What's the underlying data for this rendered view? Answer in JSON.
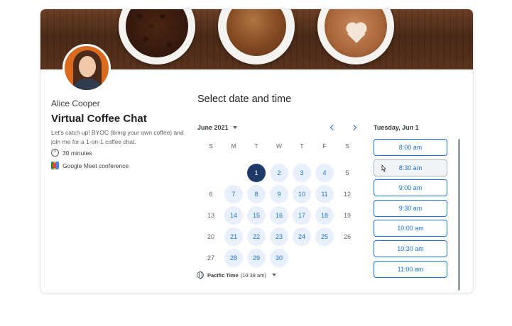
{
  "host": {
    "name": "Alice Cooper"
  },
  "event": {
    "title": "Virtual Coffee Chat",
    "description": "Let's catch up! BYOC (bring your own coffee) and join me for a 1-on-1 coffee chat.",
    "duration": "30 minutes",
    "conference": "Google Meet conference"
  },
  "scheduler": {
    "heading": "Select date and time",
    "month_label": "June 2021",
    "weekdays": [
      "S",
      "M",
      "T",
      "W",
      "T",
      "F",
      "S"
    ],
    "weeks": [
      [
        {
          "d": ""
        },
        {
          "d": ""
        },
        {
          "d": "1",
          "s": "selected"
        },
        {
          "d": "2",
          "s": "available"
        },
        {
          "d": "3",
          "s": "available"
        },
        {
          "d": "4",
          "s": "available"
        },
        {
          "d": "5",
          "s": "none"
        }
      ],
      [
        {
          "d": "6",
          "s": "none"
        },
        {
          "d": "7",
          "s": "available"
        },
        {
          "d": "8",
          "s": "available"
        },
        {
          "d": "9",
          "s": "available"
        },
        {
          "d": "10",
          "s": "available"
        },
        {
          "d": "11",
          "s": "available"
        },
        {
          "d": "12",
          "s": "none"
        }
      ],
      [
        {
          "d": "13",
          "s": "none"
        },
        {
          "d": "14",
          "s": "available"
        },
        {
          "d": "15",
          "s": "available"
        },
        {
          "d": "16",
          "s": "available"
        },
        {
          "d": "17",
          "s": "available"
        },
        {
          "d": "18",
          "s": "available"
        },
        {
          "d": "19",
          "s": "none"
        }
      ],
      [
        {
          "d": "20",
          "s": "none"
        },
        {
          "d": "21",
          "s": "available"
        },
        {
          "d": "22",
          "s": "available"
        },
        {
          "d": "23",
          "s": "available"
        },
        {
          "d": "24",
          "s": "available"
        },
        {
          "d": "25",
          "s": "available"
        },
        {
          "d": "26",
          "s": "none"
        }
      ],
      [
        {
          "d": "27",
          "s": "none"
        },
        {
          "d": "28",
          "s": "available"
        },
        {
          "d": "29",
          "s": "available"
        },
        {
          "d": "30",
          "s": "available"
        },
        {
          "d": ""
        },
        {
          "d": ""
        },
        {
          "d": ""
        }
      ]
    ],
    "timezone_name": "Pacific Time",
    "timezone_time": "(10:38 am)",
    "selected_day_label": "Tuesday, Jun 1",
    "time_slots": [
      "8:00 am",
      "8:30 am",
      "9:00 am",
      "9:30 am",
      "10:00 am",
      "10:30 am",
      "11:00 am"
    ],
    "hovered_slot": "8:30 am"
  },
  "colors": {
    "accent": "#1a73e8",
    "selected": "#1f3a68",
    "available_bg": "#e8f0fe"
  },
  "icons": [
    "clock-icon",
    "google-meet-icon",
    "chevron-left-icon",
    "chevron-right-icon",
    "globe-icon",
    "caret-down-icon",
    "pointer-cursor-icon"
  ]
}
